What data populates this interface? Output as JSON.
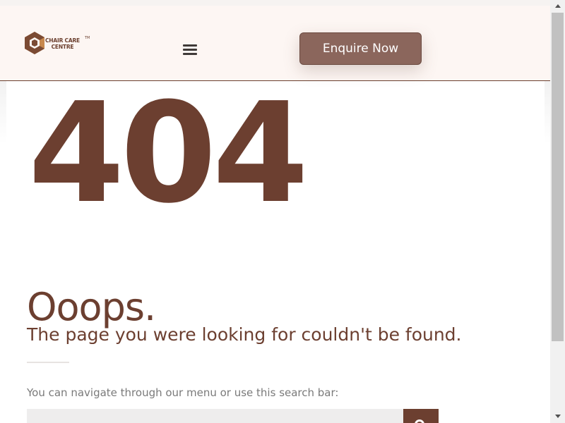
{
  "header": {
    "logo_line1": "CHAIR CARE",
    "logo_line2": "CENTRE",
    "logo_tm": "TM",
    "enquire_label": "Enquire Now"
  },
  "error": {
    "code": "404",
    "title": "Ooops.",
    "message": "The page you were looking for couldn't be found.",
    "nav_hint": "You can navigate through our menu or use this search bar:"
  },
  "search": {
    "placeholder": "",
    "value": ""
  },
  "icons": {
    "menu": "hamburger-icon",
    "search": "search-icon",
    "logo": "hexagon-c-logo"
  },
  "colors": {
    "brand": "#6c3f30",
    "button": "#8b665c",
    "header_bg": "#fdf6f3"
  }
}
